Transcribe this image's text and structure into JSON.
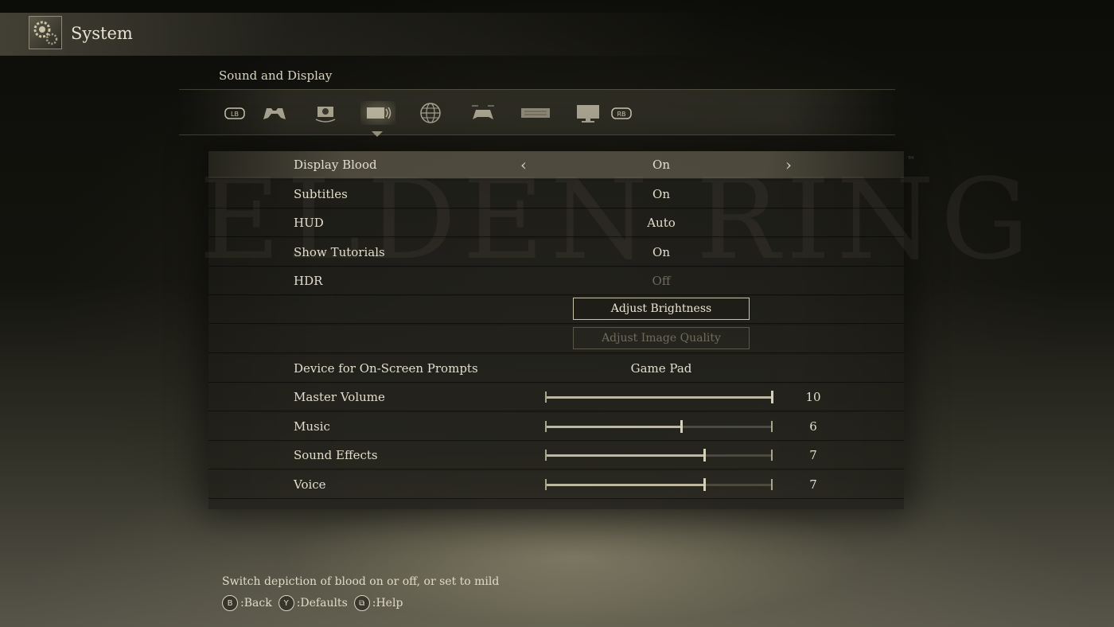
{
  "header": {
    "title": "System",
    "icon": "gear-icon"
  },
  "section": {
    "title": "Sound and Display"
  },
  "tabs": [
    {
      "name": "lb-bumper",
      "label": "LB"
    },
    {
      "name": "controller",
      "icon": "gamepad-icon"
    },
    {
      "name": "camera",
      "icon": "camera-icon"
    },
    {
      "name": "sound-display",
      "icon": "sound-display-icon",
      "active": true
    },
    {
      "name": "network",
      "icon": "globe-icon"
    },
    {
      "name": "controls",
      "icon": "controller-settings-icon"
    },
    {
      "name": "keyboard",
      "icon": "keyboard-icon"
    },
    {
      "name": "graphics",
      "icon": "monitor-icon"
    },
    {
      "name": "rb-bumper",
      "label": "RB"
    }
  ],
  "watermark": "ELDEN RING",
  "settings": {
    "display_blood": {
      "label": "Display Blood",
      "value": "On"
    },
    "subtitles": {
      "label": "Subtitles",
      "value": "On"
    },
    "hud": {
      "label": "HUD",
      "value": "Auto"
    },
    "show_tutorials": {
      "label": "Show Tutorials",
      "value": "On"
    },
    "hdr": {
      "label": "HDR",
      "value": "Off"
    },
    "adjust_brightness": {
      "label": "Adjust Brightness"
    },
    "adjust_image_quality": {
      "label": "Adjust Image Quality"
    },
    "device_prompts": {
      "label": "Device for On-Screen Prompts",
      "value": "Game Pad"
    },
    "master_volume": {
      "label": "Master Volume",
      "value": "10",
      "max": 10
    },
    "music": {
      "label": "Music",
      "value": "6",
      "max": 10
    },
    "sound_effects": {
      "label": "Sound Effects",
      "value": "7",
      "max": 10
    },
    "voice": {
      "label": "Voice",
      "value": "7",
      "max": 10
    }
  },
  "footer": {
    "help": "Switch depiction of blood on or off, or set to mild",
    "prompts": [
      {
        "button": "B",
        "label": ":Back"
      },
      {
        "button": "Y",
        "label": ":Defaults"
      },
      {
        "button": "⧉",
        "label": ":Help"
      }
    ]
  }
}
